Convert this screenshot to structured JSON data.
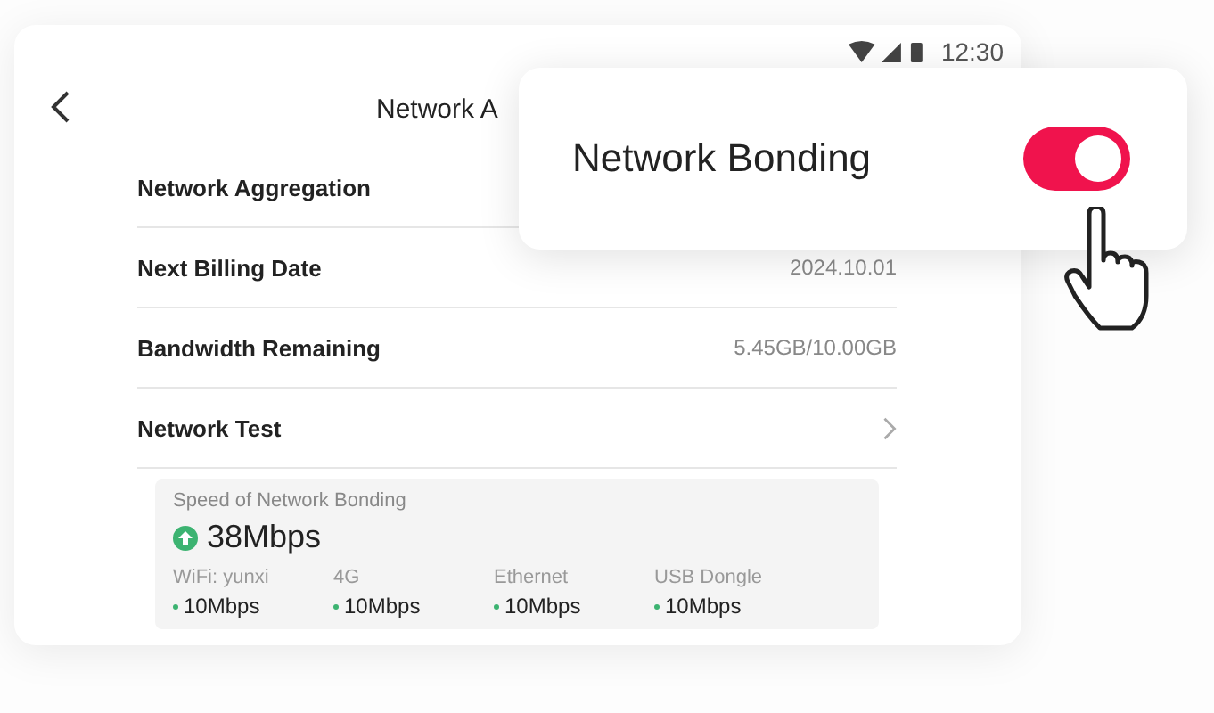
{
  "status_bar": {
    "time": "12:30"
  },
  "header": {
    "back_icon": true,
    "title": "Network A"
  },
  "rows": [
    {
      "label": "Network Aggregation"
    },
    {
      "label": "Next Billing Date",
      "value": "2024.10.01"
    },
    {
      "label": "Bandwidth Remaining",
      "value": "5.45GB/10.00GB"
    },
    {
      "label": "Network Test",
      "chevron": true
    }
  ],
  "speed_panel": {
    "title": "Speed of Network Bonding",
    "total": "38Mbps",
    "links": [
      {
        "name": "WiFi: yunxi",
        "speed": "10Mbps",
        "color": "#3cb371"
      },
      {
        "name": "4G",
        "speed": "10Mbps",
        "color": "#3cb371"
      },
      {
        "name": "Ethernet",
        "speed": "10Mbps",
        "color": "#3cb371"
      },
      {
        "name": "USB Dongle",
        "speed": "10Mbps",
        "color": "#3cb371"
      }
    ]
  },
  "popup": {
    "label": "Network Bonding",
    "on": true
  }
}
